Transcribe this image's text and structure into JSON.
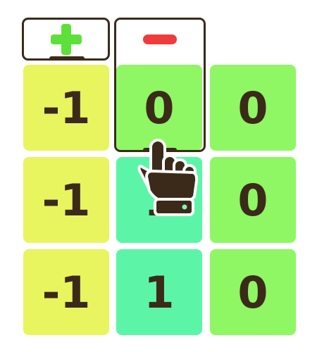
{
  "toolbar": {
    "plus_tool": {
      "icon": "plus-icon",
      "color": "#5ee03a"
    },
    "minus_tool": {
      "icon": "minus-icon",
      "color": "#ef3b3b"
    }
  },
  "grid": {
    "rows": [
      [
        {
          "value": "-1",
          "color": "#e8f55e"
        },
        {
          "value": "0",
          "color": "#8ef763"
        },
        {
          "value": "0",
          "color": "#8ef763"
        }
      ],
      [
        {
          "value": "-1",
          "color": "#e8f55e"
        },
        {
          "value": "1",
          "color": "#5cf5a8"
        },
        {
          "value": "0",
          "color": "#8ef763"
        }
      ],
      [
        {
          "value": "-1",
          "color": "#e8f55e"
        },
        {
          "value": "1",
          "color": "#5cf5a8"
        },
        {
          "value": "0",
          "color": "#8ef763"
        }
      ]
    ]
  },
  "cursor": {
    "icon": "pointing-hand-cursor-icon"
  },
  "colors": {
    "outline": "#3b2a1a"
  }
}
